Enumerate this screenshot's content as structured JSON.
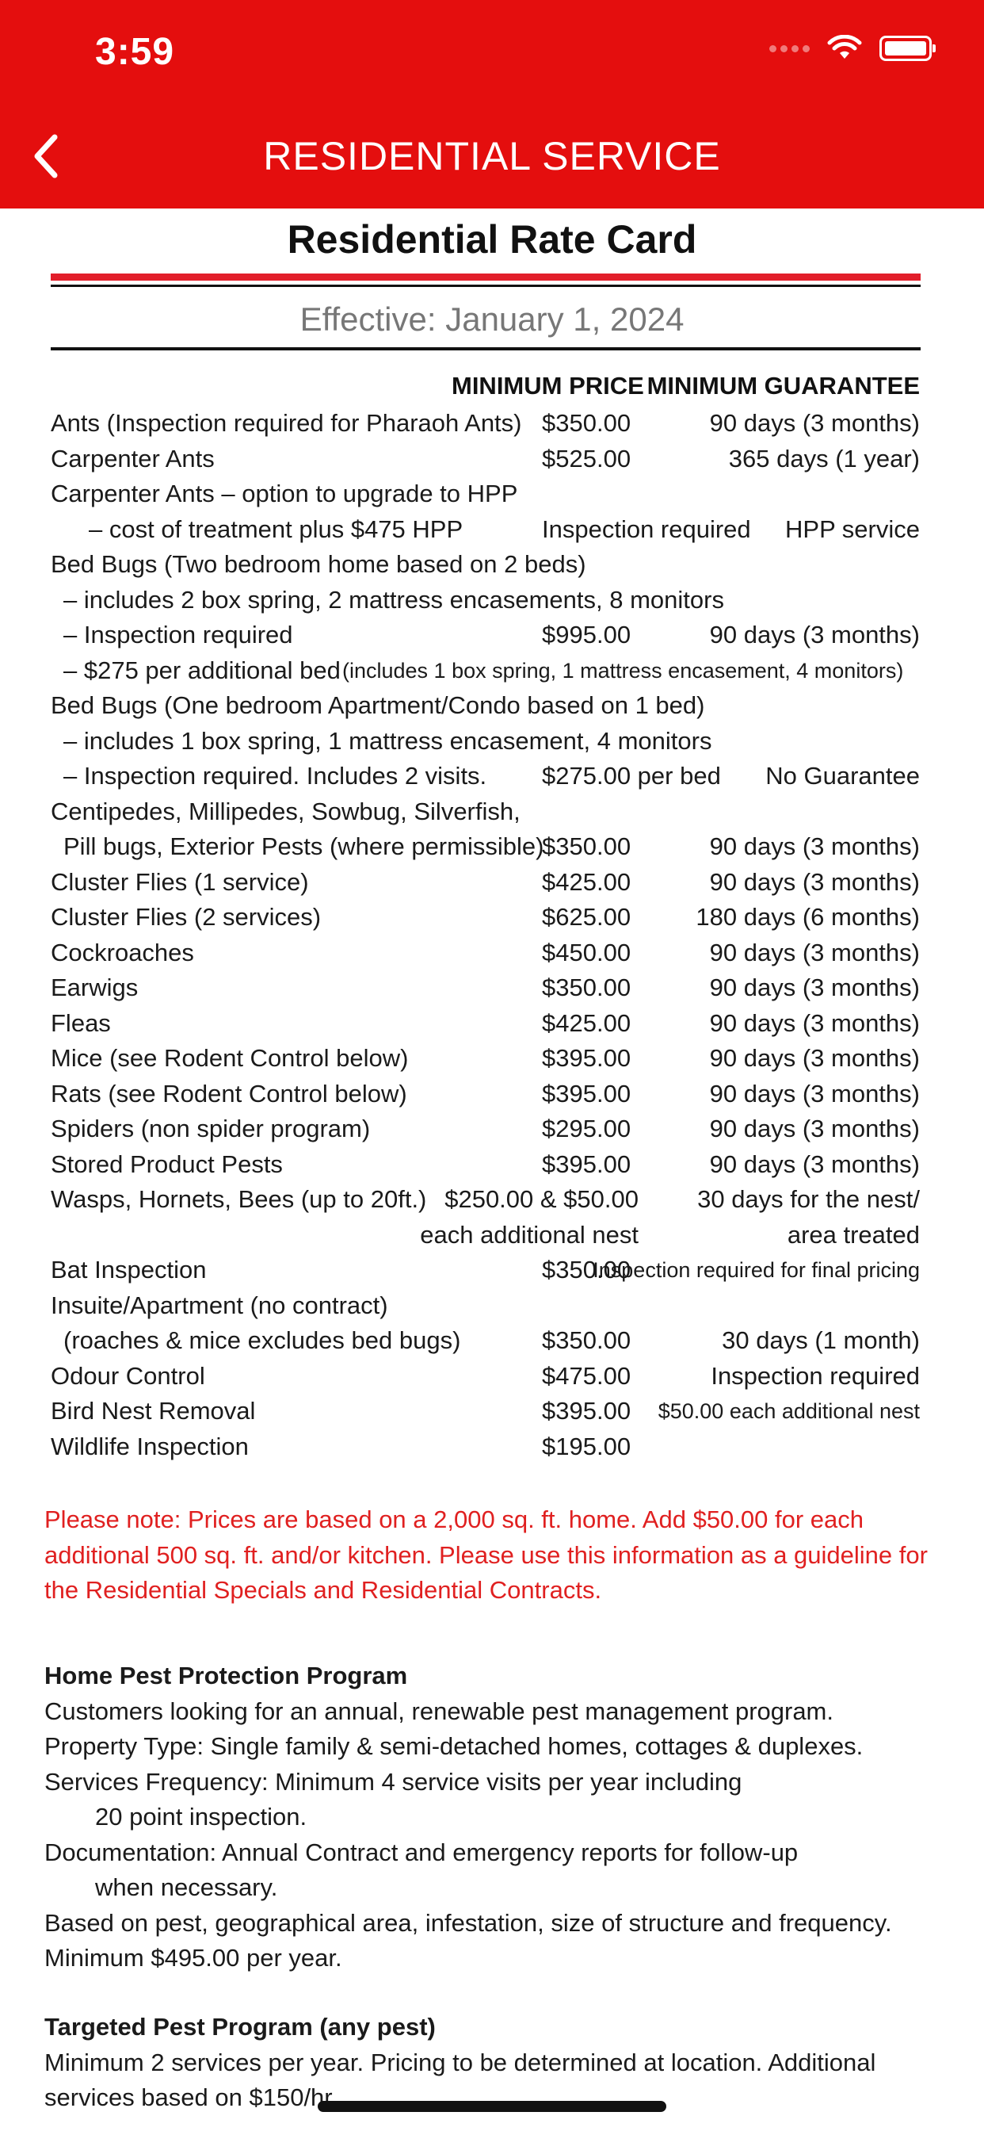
{
  "status_bar": {
    "time": "3:59"
  },
  "nav": {
    "title": "RESIDENTIAL SERVICE"
  },
  "rate_card": {
    "title": "Residential Rate Card",
    "effective": "Effective: January 1, 2024",
    "col_price": "MINIMUM PRICE",
    "col_guarantee": "MINIMUM GUARANTEE",
    "rows": [
      {
        "label": "Ants (Inspection required for Pharaoh Ants)",
        "price": "$350.00",
        "guarantee": "90 days (3 months)",
        "indent": 0
      },
      {
        "label": "Carpenter Ants",
        "price": "$525.00",
        "guarantee": "365 days (1 year)",
        "indent": 0
      },
      {
        "label": "Carpenter Ants – option to upgrade to HPP",
        "price": "",
        "guarantee": "",
        "indent": 0
      },
      {
        "label": "– cost of treatment plus $475 HPP",
        "price": "Inspection required",
        "guarantee": "HPP service",
        "indent": 2
      },
      {
        "label": "Bed Bugs (Two bedroom home based on 2 beds)",
        "price": "",
        "guarantee": "",
        "indent": 0
      },
      {
        "label": "– includes 2 box spring, 2 mattress encasements, 8 monitors",
        "price": "",
        "guarantee": "",
        "indent": 1
      },
      {
        "label": "– Inspection required",
        "price": "$995.00",
        "guarantee": "90 days (3 months)",
        "indent": 1
      },
      {
        "label": "– $275 per additional bed",
        "label_small": "(includes 1 box spring, 1 mattress encasement, 4 monitors)",
        "price": "",
        "guarantee": "",
        "indent": 1
      },
      {
        "label": "Bed Bugs (One bedroom Apartment/Condo based on 1 bed)",
        "price": "",
        "guarantee": "",
        "indent": 0
      },
      {
        "label": "– includes 1 box spring, 1 mattress encasement, 4 monitors",
        "price": "",
        "guarantee": "",
        "indent": 1
      },
      {
        "label": "– Inspection required. Includes 2 visits.",
        "price": "$275.00 per bed",
        "guarantee": "No Guarantee",
        "indent": 1
      },
      {
        "label": "Centipedes, Millipedes, Sowbug, Silverfish,",
        "price": "",
        "guarantee": "",
        "indent": 0
      },
      {
        "label": "Pill bugs, Exterior Pests (where permissible)",
        "price": "$350.00",
        "guarantee": "90 days (3 months)",
        "indent": 1
      },
      {
        "label": "Cluster Flies (1 service)",
        "price": "$425.00",
        "guarantee": "90 days (3 months)",
        "indent": 0
      },
      {
        "label": "Cluster Flies (2 services)",
        "price": "$625.00",
        "guarantee": "180 days (6 months)",
        "indent": 0
      },
      {
        "label": "Cockroaches",
        "price": "$450.00",
        "guarantee": "90 days (3 months)",
        "indent": 0
      },
      {
        "label": "Earwigs",
        "price": "$350.00",
        "guarantee": "90 days (3 months)",
        "indent": 0
      },
      {
        "label": "Fleas",
        "price": "$425.00",
        "guarantee": "90 days (3 months)",
        "indent": 0
      },
      {
        "label": "Mice (see Rodent Control below)",
        "price": "$395.00",
        "guarantee": "90 days (3 months)",
        "indent": 0
      },
      {
        "label": "Rats (see Rodent Control below)",
        "price": "$395.00",
        "guarantee": "90 days (3 months)",
        "indent": 0
      },
      {
        "label": "Spiders (non spider program)",
        "price": "$295.00",
        "guarantee": "90 days (3 months)",
        "indent": 0
      },
      {
        "label": "Stored Product Pests",
        "price": "$395.00",
        "guarantee": "90 days (3 months)",
        "indent": 0
      },
      {
        "label": "Wasps, Hornets, Bees (up to 20ft.)",
        "price": "$250.00 & $50.00",
        "guarantee": "30 days for the nest/",
        "indent": 0,
        "wide_price": true
      },
      {
        "label": "",
        "price": "each additional nest",
        "guarantee": "area treated",
        "indent": 0,
        "wide_price": true
      },
      {
        "label": "Bat Inspection",
        "price": "$350.00",
        "guarantee": "Inspection required for final pricing",
        "indent": 0,
        "small_guar": true
      },
      {
        "label": "Insuite/Apartment (no contract)",
        "price": "",
        "guarantee": "",
        "indent": 0
      },
      {
        "label": "(roaches & mice excludes bed bugs)",
        "price": "$350.00",
        "guarantee": "30 days (1 month)",
        "indent": 1
      },
      {
        "label": "Odour Control",
        "price": "$475.00",
        "guarantee": "Inspection required",
        "indent": 0
      },
      {
        "label": "Bird Nest Removal",
        "price": "$395.00",
        "guarantee": "$50.00 each additional nest",
        "indent": 0,
        "small_guar": true
      },
      {
        "label": "Wildlife Inspection",
        "price": "$195.00",
        "guarantee": "",
        "indent": 0
      }
    ]
  },
  "note": "Please note: Prices are based on a 2,000 sq. ft. home. Add $50.00 for each additional 500 sq. ft. and/or kitchen. Please use this information as a guideline for the Residential Specials and Residential Contracts.",
  "hpp": {
    "heading": "Home Pest Protection Program",
    "lines": [
      "Customers looking for an annual, renewable pest management program.",
      "Property Type: Single family & semi-detached homes, cottages & duplexes.",
      "Services Frequency: Minimum 4 service visits per year including",
      "20 point inspection.",
      "Documentation: Annual Contract and emergency reports for follow-up",
      "when necessary.",
      "Based on pest, geographical area, infestation, size of structure and frequency.",
      "Minimum $495.00 per year."
    ]
  },
  "tpp": {
    "heading": "Targeted Pest Program (any pest)",
    "lines": [
      "Minimum 2 services per year. Pricing to be determined at location. Additional",
      "services based on $150/hr."
    ]
  }
}
